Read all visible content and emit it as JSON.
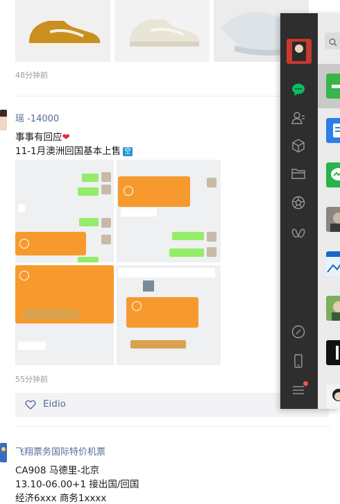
{
  "feed": {
    "post1": {
      "time": "48分钟前"
    },
    "post2": {
      "author": "瑶 -14000",
      "line1": "事事有回应",
      "line2": "11-1月澳洲回国基本上售",
      "badge": "空",
      "time": "55分钟前",
      "likes": [
        "Eidio"
      ]
    },
    "post3": {
      "author": "飞翔票务国际特价机票",
      "lines": [
        "CA908 马德里-北京",
        "13.10-06.00+1 接出国/回国",
        "经济6xxx  商务1xxxx"
      ]
    }
  },
  "wechat_sidebar": {
    "nav_icons": [
      "chat-icon",
      "contacts-icon",
      "favorites-icon",
      "files-icon",
      "moments-icon",
      "miniprogram-icon"
    ],
    "bottom_icons": [
      "link-icon",
      "phone-icon",
      "menu-icon"
    ],
    "has_menu_badge": true
  },
  "colors": {
    "link": "#576b95",
    "wechat_green": "#07c160",
    "rail": "#2e2e2e",
    "list_bg": "#ebebeb",
    "heart": "#e0284b"
  }
}
